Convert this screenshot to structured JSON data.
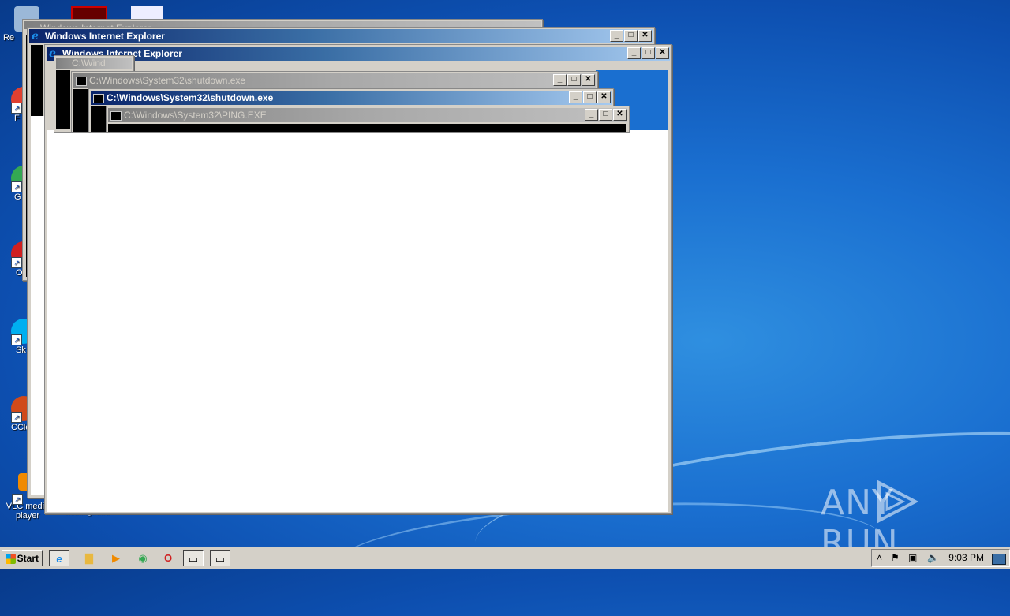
{
  "desktop": {
    "icons": [
      {
        "label": "Re",
        "color": "#9bb8d8"
      },
      {
        "label": "F",
        "color": "#e04030"
      },
      {
        "label": "G",
        "color": "#34a853"
      },
      {
        "label": "Op",
        "color": "#d02020"
      },
      {
        "label": "Sk",
        "color": "#00aff0"
      },
      {
        "label": "CCle",
        "color": "#d04a1a"
      },
      {
        "label": "VLC media player",
        "color": "#f08a00"
      }
    ],
    "partial_label": "nothing.rtf.rtf"
  },
  "windows": {
    "ie_back": {
      "title": "Windows Internet Explorer",
      "state": "active"
    },
    "ie_front": {
      "title": "Windows Internet Explorer",
      "state": "active"
    },
    "cmd_shutdown_back": {
      "title": "C:\\Windows\\System32\\shutdown.exe",
      "state": "inactive"
    },
    "cmd_shutdown_front": {
      "title": "C:\\Windows\\System32\\shutdown.exe",
      "state": "active"
    },
    "cmd_ping": {
      "title": "C:\\Windows\\System32\\PING.EXE",
      "state": "inactive"
    },
    "cmd_partial": {
      "title": "C:\\Wind",
      "state": "inactive"
    },
    "top_partial": {
      "title": "Windows Internet Explorer",
      "state": "inactive"
    }
  },
  "caption_buttons": {
    "minimize": "_",
    "maximize": "□",
    "close": "✕"
  },
  "taskbar": {
    "start_label": "Start",
    "items": [
      {
        "name": "ie",
        "icon": "ie-icon",
        "glyph": "e"
      },
      {
        "name": "explorer",
        "icon": "folder-icon",
        "glyph": "▇"
      },
      {
        "name": "media",
        "icon": "media-player-icon",
        "glyph": "▶"
      },
      {
        "name": "chrome",
        "icon": "chrome-icon",
        "glyph": "◉"
      },
      {
        "name": "opera",
        "icon": "opera-icon",
        "glyph": "O"
      },
      {
        "name": "cmd1",
        "icon": "cmd-icon",
        "glyph": "▭"
      },
      {
        "name": "cmd2",
        "icon": "cmd-icon",
        "glyph": "▭"
      }
    ],
    "clock": "9:03 PM"
  },
  "watermark": {
    "left": "ANY",
    "right": "RUN"
  }
}
